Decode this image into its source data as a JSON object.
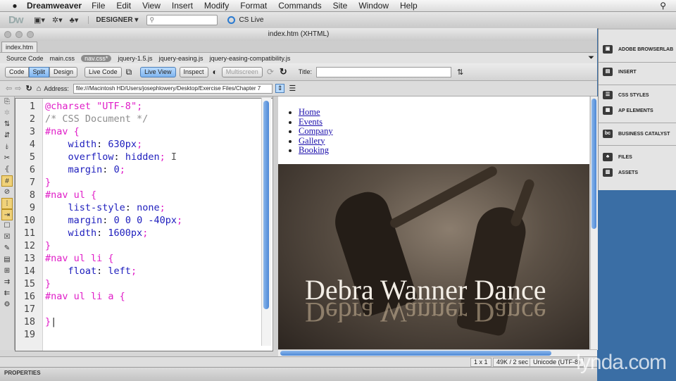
{
  "menubar": {
    "app_name": "Dreamweaver",
    "items": [
      "File",
      "Edit",
      "View",
      "Insert",
      "Modify",
      "Format",
      "Commands",
      "Site",
      "Window",
      "Help"
    ]
  },
  "app_toolbar": {
    "logo": "Dw",
    "workspace": "DESIGNER ▾",
    "cs_live": "CS Live"
  },
  "document": {
    "window_title": "index.htm (XHTML)",
    "tab": "index.htm",
    "related_files": [
      "Source Code",
      "main.css",
      "nav.css*",
      "jquery-1.5.js",
      "jquery-easing.js",
      "jquery-easing-compatibility.js"
    ],
    "active_related": "nav.css*",
    "view_buttons": [
      "Code",
      "Split",
      "Design"
    ],
    "active_view": "Split",
    "live_code": "Live Code",
    "live_view": "Live View",
    "inspect": "Inspect",
    "multiscreen": "Multiscreen",
    "title_label": "Title:",
    "address_label": "Address:",
    "address_value": "file:///Macintosh HD/Users/josephlowery/Desktop/Exercise Files/Chapter 7"
  },
  "code": {
    "line_numbers": [
      "1",
      "2",
      "3",
      "4",
      "5",
      "6",
      "7",
      "8",
      "9",
      "10",
      "11",
      "12",
      "13",
      "14",
      "15",
      "16",
      "17",
      "18",
      "19"
    ]
  },
  "live": {
    "nav_items": [
      "Home",
      "Events",
      "Company",
      "Gallery",
      "Booking"
    ],
    "hero_title": "Debra Wanner Dance"
  },
  "status": {
    "size": "1 x 1",
    "download": "49K / 2 sec",
    "encoding": "Unicode (UTF-8)"
  },
  "properties_label": "PROPERTIES",
  "panels": [
    "ADOBE BROWSERLAB",
    "INSERT",
    "CSS STYLES",
    "AP ELEMENTS",
    "BUSINESS CATALYST",
    "FILES",
    "ASSETS"
  ],
  "watermark": "lynda.com"
}
